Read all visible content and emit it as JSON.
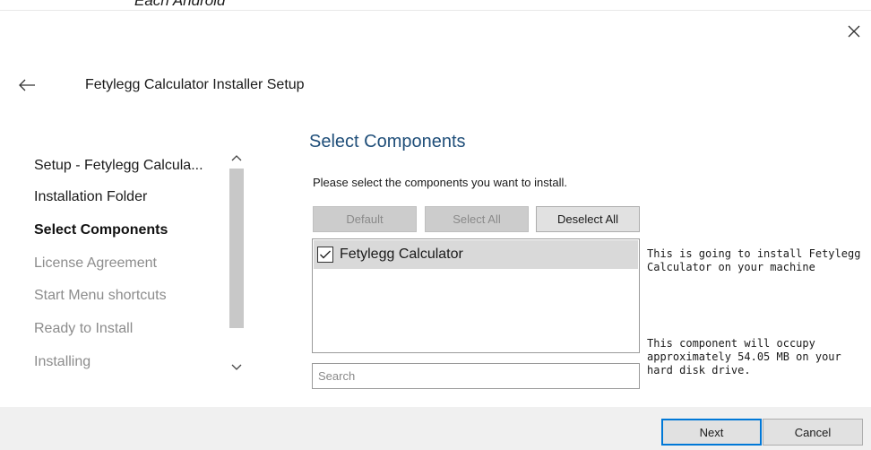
{
  "partial_top_text": "Each Android",
  "window": {
    "title": "Fetylegg Calculator Installer Setup"
  },
  "steps": {
    "items": [
      {
        "label": "Setup - Fetylegg Calcula...",
        "state": "done"
      },
      {
        "label": "Installation Folder",
        "state": "done"
      },
      {
        "label": "Select Components",
        "state": "active"
      },
      {
        "label": "License Agreement",
        "state": "pending"
      },
      {
        "label": "Start Menu shortcuts",
        "state": "pending"
      },
      {
        "label": "Ready to Install",
        "state": "pending"
      },
      {
        "label": "Installing",
        "state": "pending"
      }
    ]
  },
  "page": {
    "title": "Select Components",
    "instruction": "Please select the components you want to install."
  },
  "buttons": {
    "default_label": "Default",
    "select_all_label": "Select All",
    "deselect_all_label": "Deselect All"
  },
  "components": [
    {
      "label": "Fetylegg Calculator",
      "checked": true
    }
  ],
  "search": {
    "placeholder": "Search",
    "value": ""
  },
  "description": {
    "component": "This is going to install Fetylegg Calculator on your machine",
    "size": "This component will occupy approximately 54.05 MB on your hard disk drive."
  },
  "footer": {
    "next_label": "Next",
    "cancel_label": "Cancel"
  },
  "colors": {
    "section_title": "#1f4e79",
    "next_border": "#0078d7",
    "disabled_button": "#cccccc",
    "footer_bg": "#f0f0f0"
  },
  "icons": {
    "close": "close-icon",
    "back": "back-arrow-icon",
    "scroll_up": "chevron-up-icon",
    "scroll_down": "chevron-down-icon",
    "check": "checkmark-icon"
  }
}
